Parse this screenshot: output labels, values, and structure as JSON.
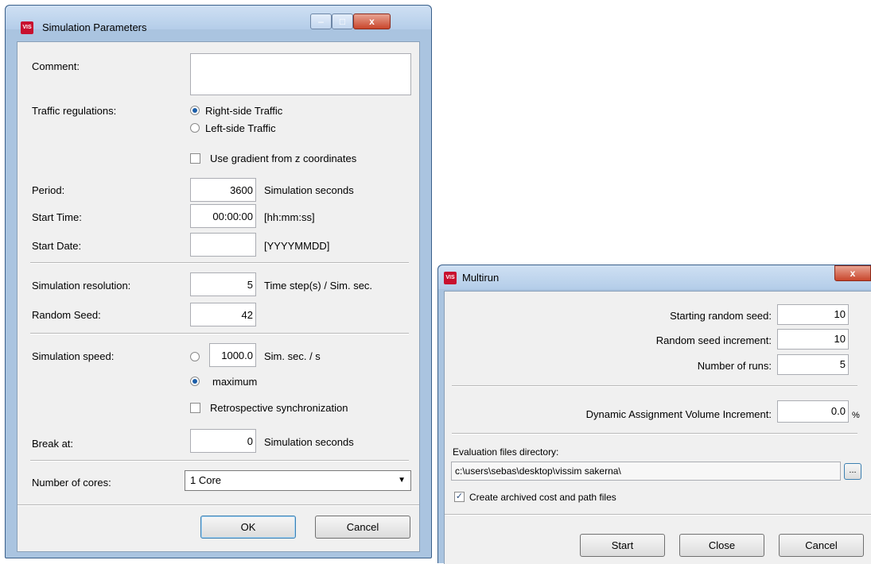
{
  "sim": {
    "title": "Simulation Parameters",
    "app_icon_text": "VIS",
    "minimize": "–",
    "maximize": "□",
    "close": "x",
    "comment_label": "Comment:",
    "comment_value": "",
    "traffic_label": "Traffic regulations:",
    "right_side": "Right-side Traffic",
    "left_side": "Left-side Traffic",
    "right_side_selected": true,
    "gradient_label": "Use gradient from z coordinates",
    "gradient_checked": false,
    "period_label": "Period:",
    "period_value": "3600",
    "period_unit": "Simulation seconds",
    "start_time_label": "Start Time:",
    "start_time_value": "00:00:00",
    "start_time_unit": "[hh:mm:ss]",
    "start_date_label": "Start Date:",
    "start_date_value": "",
    "start_date_unit": "[YYYYMMDD]",
    "resolution_label": "Simulation resolution:",
    "resolution_value": "5",
    "resolution_unit": "Time step(s) / Sim. sec.",
    "seed_label": "Random Seed:",
    "seed_value": "42",
    "speed_label": "Simulation speed:",
    "speed_value": "1000.0",
    "speed_unit": "Sim. sec. / s",
    "speed_max_label": "maximum",
    "speed_max_selected": true,
    "retro_label": "Retrospective synchronization",
    "retro_checked": false,
    "break_label": "Break at:",
    "break_value": "0",
    "break_unit": "Simulation seconds",
    "cores_label": "Number of cores:",
    "cores_value": "1 Core",
    "ok": "OK",
    "cancel": "Cancel"
  },
  "multirun": {
    "title": "Multirun",
    "app_icon_text": "VIS",
    "close": "x",
    "start_seed_label": "Starting random seed:",
    "start_seed_value": "10",
    "seed_inc_label": "Random seed increment:",
    "seed_inc_value": "10",
    "runs_label": "Number of runs:",
    "runs_value": "5",
    "dyn_label": "Dynamic Assignment Volume Increment:",
    "dyn_value": "0.0",
    "dyn_unit": "%",
    "eval_dir_label": "Evaluation files directory:",
    "eval_dir_value": "c:\\users\\sebas\\desktop\\vissim sakerna\\",
    "browse": "...",
    "archive_label": "Create archived cost and path files",
    "archive_checked": true,
    "start": "Start",
    "close_btn": "Close",
    "cancel": "Cancel"
  },
  "icons": {
    "app": "vissim-app-icon",
    "dropdown": "chevron-down-icon",
    "check": "checkmark-icon"
  }
}
